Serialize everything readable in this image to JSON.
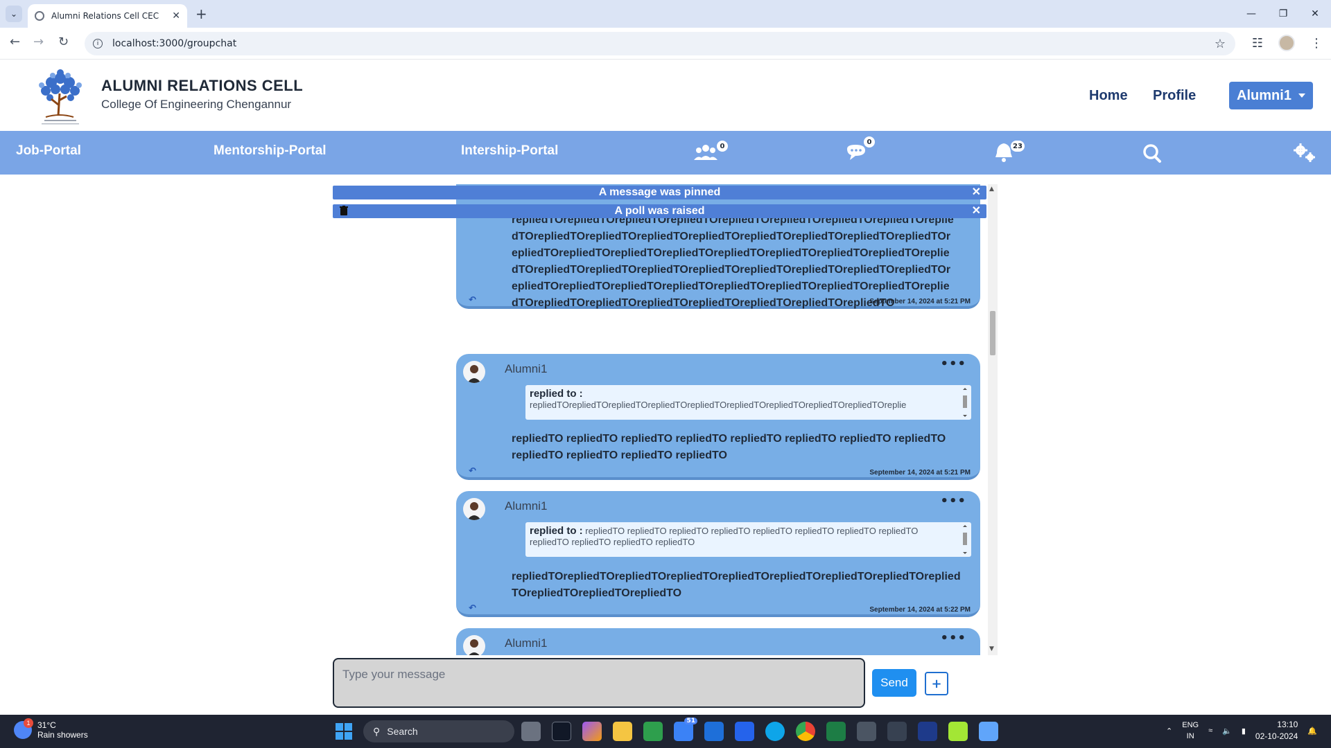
{
  "browser": {
    "tab_title": "Alumni Relations Cell CEC",
    "url": "localhost:3000/groupchat"
  },
  "header": {
    "title": "ALUMNI RELATIONS CELL",
    "subtitle": "College Of Engineering Chengannur",
    "nav": {
      "home": "Home",
      "profile": "Profile"
    },
    "user_menu": "Alumni1"
  },
  "bluenav": {
    "job": "Job-Portal",
    "mentorship": "Mentorship-Portal",
    "internship": "Intership-Portal",
    "groups_count": "0",
    "messages_count": "0",
    "notifications_count": "23"
  },
  "chat": {
    "pinned_banner": "A message was pinned",
    "poll_banner": "A poll was raised",
    "messages": [
      {
        "body": "repliedTOrepliedTOrepliedTOrepliedTOrepliedTOrepliedTOrepliedTOrepliedTOrepliedTOrepliedTOrepliedTOrepliedTOrepliedTOrepliedTOrepliedTOrepliedTOrepliedTOrepliedTOrepliedTOrepliedTOrepliedTOrepliedTOrepliedTOrepliedTOrepliedTOrepliedTOrepliedTOrepliedTOrepliedTOrepliedTOrepliedTOrepliedTOrepliedTOrepliedTOrepliedTOrepliedTOrepliedTOrepliedTOrepliedTOrepliedTOrepliedTOrepliedTOrepliedTOrepliedTOrepliedTOrepliedTOrepliedTOrepliedTOrepliedTOrepliedTO",
        "timestamp": "September 14, 2024 at 5:21 PM"
      },
      {
        "user": "Alumni1",
        "reply_label": "replied to :",
        "reply_text": "repliedTOrepliedTOrepliedTOrepliedTOrepliedTOrepliedTOrepliedTOrepliedTOrepliedTOreplie",
        "body": "repliedTO repliedTO repliedTO repliedTO repliedTO repliedTO repliedTO repliedTO repliedTO repliedTO repliedTO repliedTO",
        "timestamp": "September 14, 2024 at 5:21 PM"
      },
      {
        "user": "Alumni1",
        "reply_label": "replied to :",
        "reply_text": "repliedTO repliedTO repliedTO repliedTO repliedTO repliedTO repliedTO repliedTO repliedTO repliedTO repliedTO repliedTO",
        "body": "repliedTOrepliedTOrepliedTOrepliedTOrepliedTOrepliedTOrepliedTOrepliedTOrepliedTOrepliedTOrepliedTOrepliedTO",
        "timestamp": "September 14, 2024 at 5:22 PM"
      },
      {
        "user": "Alumni1"
      }
    ],
    "input_placeholder": "Type your message",
    "send_label": "Send",
    "plus_label": "+"
  },
  "taskbar": {
    "temperature": "31°C",
    "weather": "Rain showers",
    "weather_badge": "1",
    "search_label": "Search",
    "mail_badge": "51",
    "lang_top": "ENG",
    "lang_bottom": "IN",
    "time": "13:10",
    "date": "02-10-2024"
  }
}
